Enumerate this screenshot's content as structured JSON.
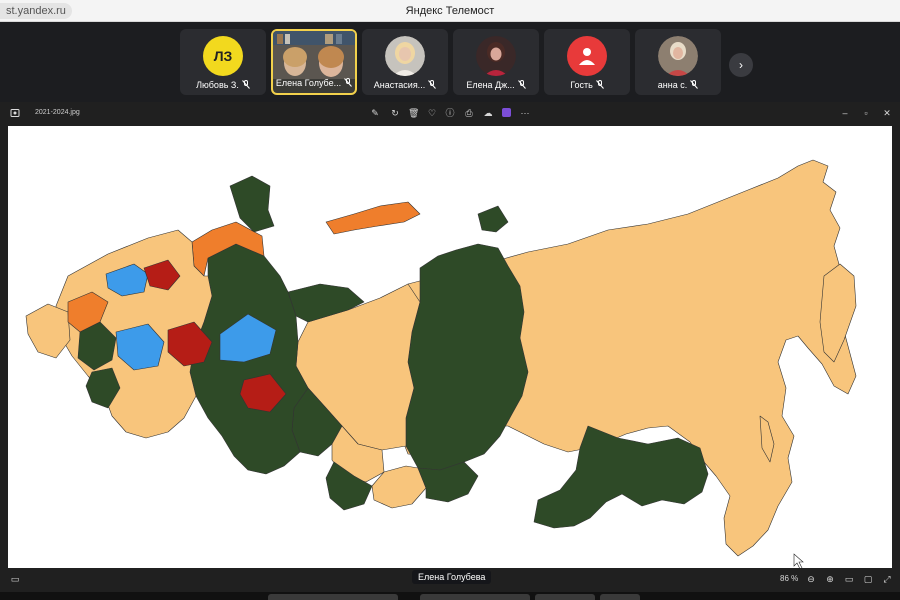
{
  "browser": {
    "url": "st.yandex.ru",
    "title": "Яндекс Телемост"
  },
  "participants": [
    {
      "name": "Любовь З.",
      "initials": "ЛЗ",
      "avatar_color": "#f2d91e",
      "muted": true
    },
    {
      "name": "Елена Голубе...",
      "active": true,
      "muted": true
    },
    {
      "name": "Анастасия...",
      "muted": true
    },
    {
      "name": "Елена Дж...",
      "muted": true
    },
    {
      "name": "Гость",
      "avatar_color": "#e83a3a",
      "muted": true
    },
    {
      "name": "анна с.",
      "muted": true
    }
  ],
  "next_icon": "chevron-right-icon",
  "viewer": {
    "file_name": "2021-2024.jpg",
    "zoom": "86 %",
    "speaker": "Елена Голубева",
    "map_colors": {
      "dark_green": "#2e4a27",
      "light_orange": "#f8c57c",
      "orange": "#ef7e2c",
      "blue": "#3d9bea",
      "red": "#b51d16"
    }
  }
}
